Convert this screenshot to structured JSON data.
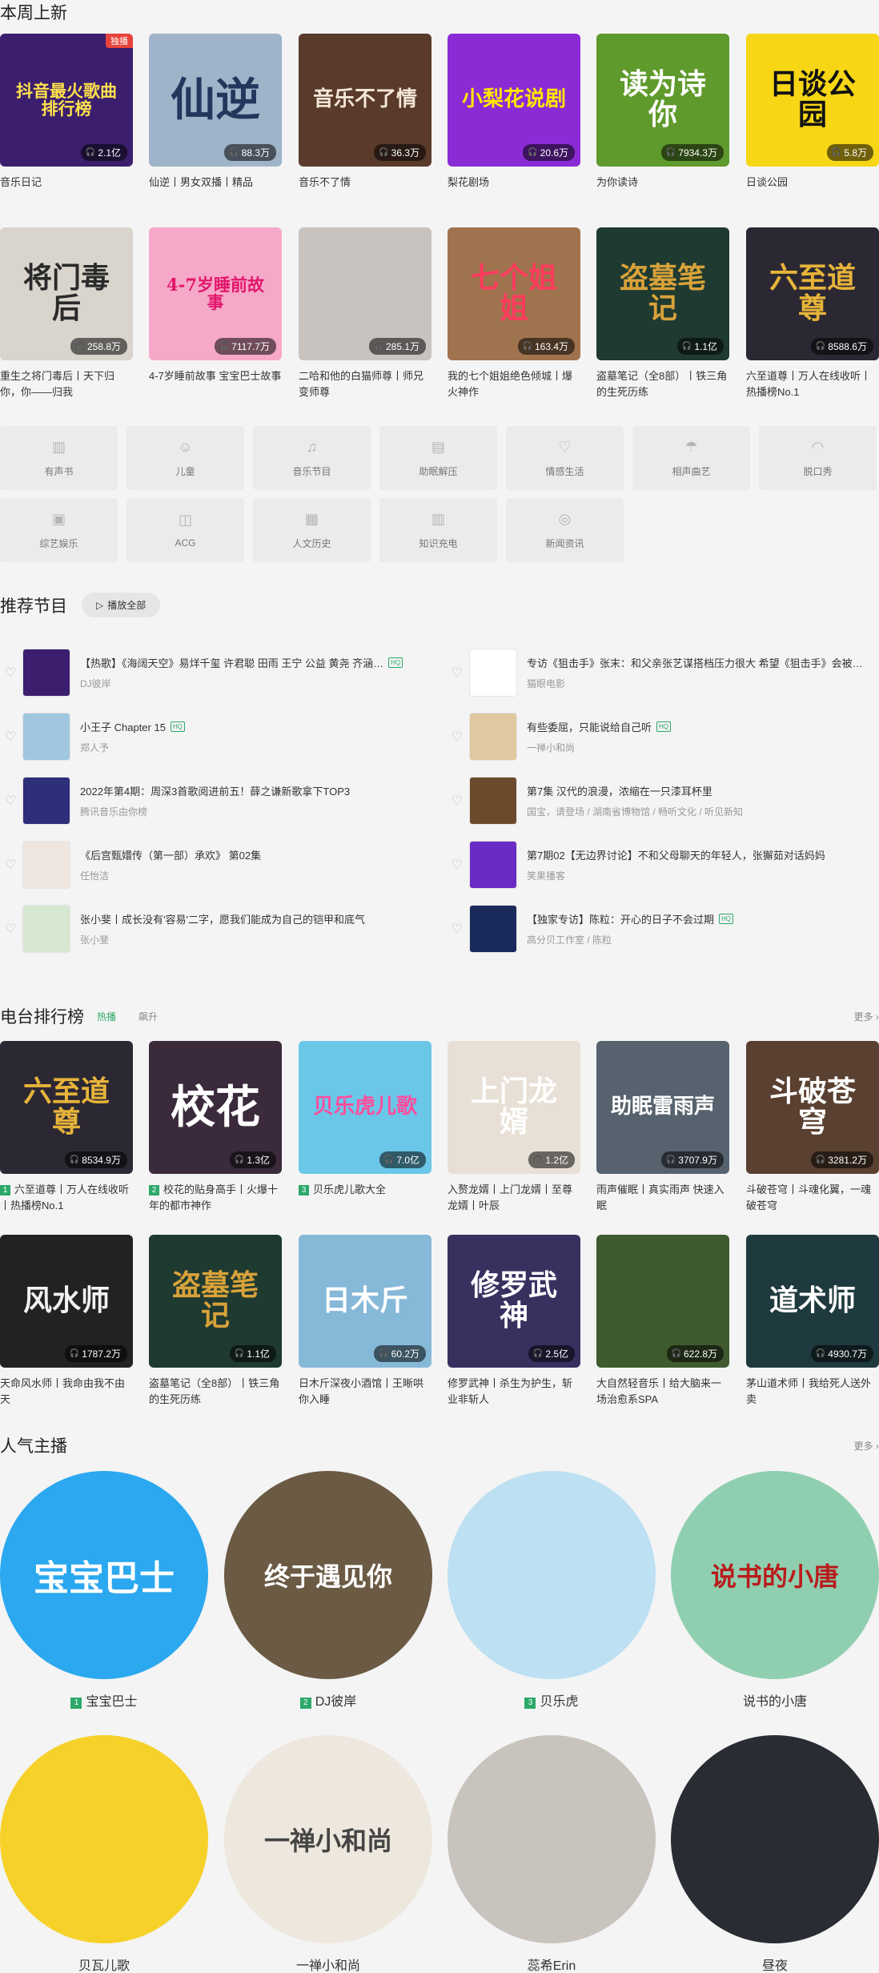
{
  "weekly": {
    "title": "本周上新",
    "cards": [
      {
        "title": "音乐日记",
        "count": "2.1亿",
        "bg": "#3b1f6e",
        "art": "抖音最火歌曲排行榜",
        "artColor": "#ffe14d",
        "badge": "独播"
      },
      {
        "title": "仙逆丨男女双播丨精品",
        "count": "88.3万",
        "bg": "#9fb4c9",
        "art": "仙逆",
        "artColor": "#22375c"
      },
      {
        "title": "音乐不了情",
        "count": "36.3万",
        "bg": "#5a3a2a",
        "art": "音乐不了情",
        "artColor": "#f2e6d8"
      },
      {
        "title": "梨花剧场",
        "count": "20.6万",
        "bg": "#8a2bd6",
        "art": "小梨花说剧",
        "artColor": "#ffe600"
      },
      {
        "title": "为你读诗",
        "count": "7934.3万",
        "bg": "#5f9a2c",
        "art": "读为诗你",
        "artColor": "#ffffff"
      },
      {
        "title": "日谈公园",
        "count": "5.8万",
        "bg": "#f7d615",
        "art": "日谈公园",
        "artColor": "#111111"
      }
    ]
  },
  "weekly2": {
    "cards": [
      {
        "title": "重生之将门毒后丨天下归你，你——归我",
        "count": "258.8万",
        "bg": "#d9d4cc",
        "art": "将门毒后",
        "artColor": "#2a2a2a"
      },
      {
        "title": "4-7岁睡前故事 宝宝巴士故事",
        "count": "7117.7万",
        "bg": "#f6a8c8",
        "art": "4-7岁睡前故事",
        "artColor": "#e2156b"
      },
      {
        "title": "二哈和他的白猫师尊丨师兄变师尊",
        "count": "285.1万",
        "bg": "#c9c3c0",
        "art": "",
        "artColor": "#444"
      },
      {
        "title": "我的七个姐姐绝色倾城丨爆火神作",
        "count": "163.4万",
        "bg": "#a0734f",
        "art": "七个姐姐",
        "artColor": "#ff3b5c"
      },
      {
        "title": "盗墓笔记（全8部）丨铁三角的生死历练",
        "count": "1.1亿",
        "bg": "#1f3a30",
        "art": "盗墓笔记",
        "artColor": "#d8a23a"
      },
      {
        "title": "六至道尊丨万人在线收听丨热播榜No.1",
        "count": "8588.6万",
        "bg": "#2c2833",
        "art": "六至道尊",
        "artColor": "#e7b43a"
      }
    ]
  },
  "categories": [
    {
      "label": "有声书",
      "icon": "book-icon",
      "glyph": "▥"
    },
    {
      "label": "儿童",
      "icon": "child-icon",
      "glyph": "☺"
    },
    {
      "label": "音乐节目",
      "icon": "music-note-icon",
      "glyph": "♫"
    },
    {
      "label": "助眠解压",
      "icon": "open-book-icon",
      "glyph": "▤"
    },
    {
      "label": "情感生活",
      "icon": "heart-icon",
      "glyph": "♡"
    },
    {
      "label": "相声曲艺",
      "icon": "umbrella-icon",
      "glyph": "☂"
    },
    {
      "label": "脱口秀",
      "icon": "lips-icon",
      "glyph": "◠"
    },
    {
      "label": "综艺娱乐",
      "icon": "tv-icon",
      "glyph": "▣"
    },
    {
      "label": "ACG",
      "icon": "gamepad-icon",
      "glyph": "◫"
    },
    {
      "label": "人文历史",
      "icon": "document-icon",
      "glyph": "▦"
    },
    {
      "label": "知识充电",
      "icon": "book-open-icon",
      "glyph": "▥"
    },
    {
      "label": "新闻资讯",
      "icon": "radio-icon",
      "glyph": "◎"
    }
  ],
  "recommend": {
    "title": "推荐节目",
    "play_all": "播放全部",
    "items": [
      {
        "title": "【热歌】《海阔天空》易烊千玺 许君聪 田雨 王宁 公益 黄尧 齐涵…",
        "sub": "DJ彼岸",
        "hq": "HQ",
        "bg": "#3b1f6e"
      },
      {
        "title": "专访《狙击手》张末：和父亲张艺谋搭档压力很大 希望《狙击手》会被…",
        "sub": "猫眼电影",
        "hq": "",
        "bg": "#ffffff"
      },
      {
        "title": "小王子 Chapter 15",
        "sub": "郑人予",
        "hq": "HQ",
        "bg": "#9fc7e0"
      },
      {
        "title": "有些委屈，只能说给自己听",
        "sub": "一禅小和尚",
        "hq": "HQ",
        "bg": "#e0c9a0"
      },
      {
        "title": "2022年第4期：周深3首歌阅进前五！薛之谦新歌拿下TOP3",
        "sub": "腾讯音乐由你榜",
        "hq": "",
        "bg": "#2d2f7a"
      },
      {
        "title": "第7集 汉代的浪漫，浓缩在一只漆耳杯里",
        "sub": "国宝，请登场 / 湖南省博物馆 / 畅听文化 / 听见新知",
        "hq": "",
        "bg": "#6b4a2c"
      },
      {
        "title": "《后宫甄嬛传（第一部）承欢》 第02集",
        "sub": "任怡洁",
        "hq": "",
        "bg": "#efe6e0"
      },
      {
        "title": "第7期02【无边界讨论】不和父母聊天的年轻人，张獬茹对话妈妈",
        "sub": "笑果播客",
        "hq": "",
        "bg": "#6a2bc4"
      },
      {
        "title": "张小斐丨成长没有'容易'二字，愿我们能成为自己的铠甲和底气",
        "sub": "张小斐",
        "hq": "",
        "bg": "#d6e8d0"
      },
      {
        "title": "【独家专访】陈粒：开心的日子不会过期",
        "sub": "高分贝工作室 / 陈粒",
        "hq": "HQ",
        "bg": "#1a2a5c"
      }
    ]
  },
  "ranking": {
    "title": "电台排行榜",
    "tabs": [
      "热播",
      "飙升"
    ],
    "more": "更多 ›",
    "cards": [
      {
        "rank": "1",
        "title": "六至道尊丨万人在线收听丨热播榜No.1",
        "count": "8534.9万",
        "bg": "#2c2833",
        "art": "六至道尊",
        "artColor": "#e7b43a"
      },
      {
        "rank": "2",
        "title": "校花的贴身高手丨火爆十年的都市神作",
        "count": "1.3亿",
        "bg": "#3a2a3c",
        "art": "校花",
        "artColor": "#ffffff"
      },
      {
        "rank": "3",
        "title": "贝乐虎儿歌大全",
        "count": "7.0亿",
        "bg": "#6ac7e8",
        "art": "贝乐虎儿歌",
        "artColor": "#ff4e9e"
      },
      {
        "rank": "",
        "title": "入赘龙婿丨上门龙婿丨至尊龙婿丨叶辰",
        "count": "1.2亿",
        "bg": "#e8e0d6",
        "art": "上门龙婿",
        "artColor": "#ffffff"
      },
      {
        "rank": "",
        "title": "雨声催眠丨真实雨声 快速入眠",
        "count": "3707.9万",
        "bg": "#56636e",
        "art": "助眠雷雨声",
        "artColor": "#ffffff"
      },
      {
        "rank": "",
        "title": "斗破苍穹丨斗魂化翼，一魂破苍穹",
        "count": "3281.2万",
        "bg": "#5a4030",
        "art": "斗破苍穹",
        "artColor": "#ffffff"
      },
      {
        "rank": "",
        "title": "天命风水师丨我命由我不由天",
        "count": "1787.2万",
        "bg": "#222222",
        "art": "风水师",
        "artColor": "#f2f2f2"
      },
      {
        "rank": "",
        "title": "盗墓笔记（全8部）丨铁三角的生死历练",
        "count": "1.1亿",
        "bg": "#1f3a30",
        "art": "盗墓笔记",
        "artColor": "#d8a23a"
      },
      {
        "rank": "",
        "title": "日木斤深夜小酒馆丨王晰哄你入睡",
        "count": "60.2万",
        "bg": "#86b8d8",
        "art": "日木斤",
        "artColor": "#ffffff"
      },
      {
        "rank": "",
        "title": "修罗武神丨杀生为护生，斩业非斩人",
        "count": "2.5亿",
        "bg": "#3a3060",
        "art": "修罗武神",
        "artColor": "#ffffff"
      },
      {
        "rank": "",
        "title": "大自然轻音乐丨给大脑来一场治愈系SPA",
        "count": "622.8万",
        "bg": "#3e5a2e",
        "art": "",
        "artColor": "#ffffff"
      },
      {
        "rank": "",
        "title": "茅山道术师丨我给死人送外卖",
        "count": "4930.7万",
        "bg": "#1f3a3e",
        "art": "道术师",
        "artColor": "#ffffff"
      }
    ]
  },
  "hosts": {
    "title": "人气主播",
    "more": "更多 ›",
    "items": [
      {
        "rank": "1",
        "name": "宝宝巴士",
        "bg": "#2ba8ef",
        "art": "宝宝巴士",
        "artColor": "#ffffff"
      },
      {
        "rank": "2",
        "name": "DJ彼岸",
        "bg": "#6b5a44",
        "art": "终于遇见你",
        "artColor": "#ffffff"
      },
      {
        "rank": "3",
        "name": "贝乐虎",
        "bg": "#bde0f2",
        "art": "",
        "artColor": "#333"
      },
      {
        "rank": "",
        "name": "说书的小唐",
        "bg": "#8fcfb0",
        "art": "说书的小唐",
        "artColor": "#b81c1c"
      },
      {
        "rank": "",
        "name": "贝瓦儿歌",
        "bg": "#f6d12a",
        "art": "",
        "artColor": "#333"
      },
      {
        "rank": "",
        "name": "一禅小和尚",
        "bg": "#ede7dd",
        "art": "一禅小和尚",
        "artColor": "#444"
      },
      {
        "rank": "",
        "name": "蕊希Erin",
        "bg": "#c9c3be",
        "art": "",
        "artColor": "#333"
      },
      {
        "rank": "",
        "name": "昼夜",
        "bg": "#2a2c33",
        "art": "",
        "artColor": "#ddd"
      }
    ]
  }
}
